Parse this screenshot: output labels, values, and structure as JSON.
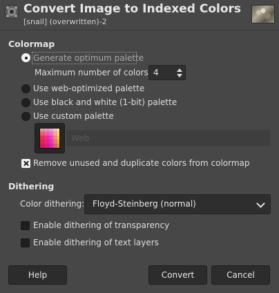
{
  "dialog": {
    "title": "Convert Image to Indexed Colors",
    "subtitle": "[snail] (overwritten)-2"
  },
  "colormap": {
    "heading": "Colormap",
    "options": [
      {
        "label": "Generate optimum palette",
        "selected": true
      },
      {
        "label": "Use web-optimized palette",
        "selected": false
      },
      {
        "label": "Use black and white (1-bit) palette",
        "selected": false
      },
      {
        "label": "Use custom palette",
        "selected": false
      }
    ],
    "max_colors_label": "Maximum number of colors:",
    "max_colors_value": "4",
    "custom_palette_name": "Web",
    "remove_unused_label": "Remove unused and duplicate colors from colormap",
    "remove_unused_checked": true
  },
  "dithering": {
    "heading": "Dithering",
    "color_dithering_label": "Color dithering:",
    "color_dithering_value": "Floyd-Steinberg (normal)",
    "transparency_label": "Enable dithering of transparency",
    "transparency_checked": false,
    "text_layers_label": "Enable dithering of text layers",
    "text_layers_checked": false
  },
  "buttons": {
    "help": "Help",
    "convert": "Convert",
    "cancel": "Cancel"
  },
  "icons": {
    "app_icon": "gimp-wilber-icon",
    "thumbnail": "image-thumbnail"
  }
}
